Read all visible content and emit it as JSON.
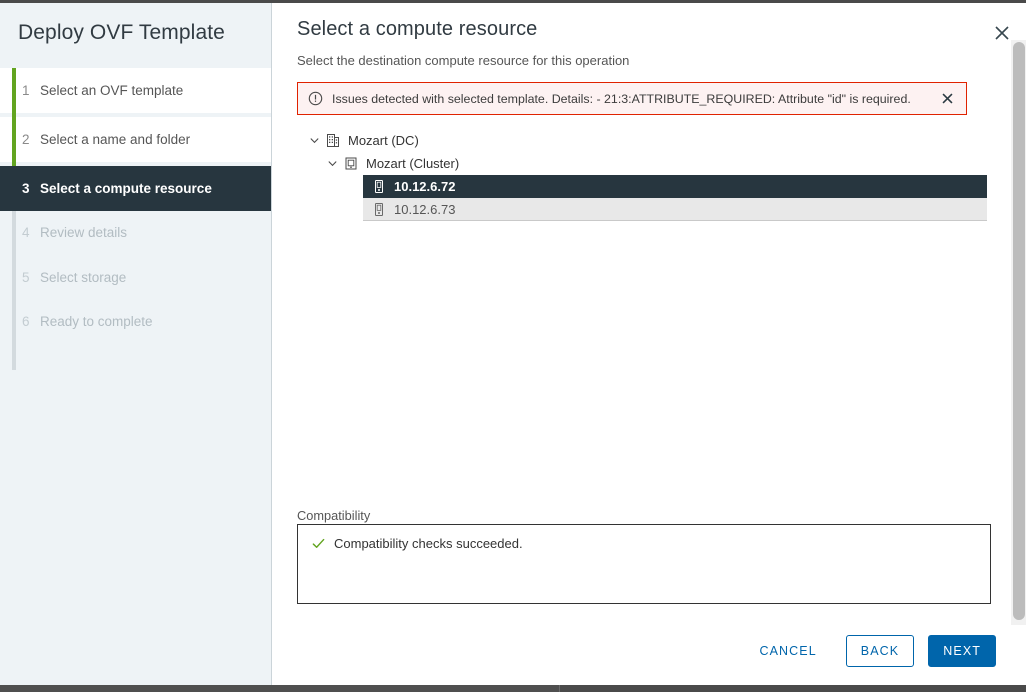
{
  "wizard": {
    "title": "Deploy OVF Template",
    "steps": [
      {
        "num": "1",
        "label": "Select an OVF template",
        "state": "done"
      },
      {
        "num": "2",
        "label": "Select a name and folder",
        "state": "done"
      },
      {
        "num": "3",
        "label": "Select a compute resource",
        "state": "active"
      },
      {
        "num": "4",
        "label": "Review details",
        "state": "off"
      },
      {
        "num": "5",
        "label": "Select storage",
        "state": "off"
      },
      {
        "num": "6",
        "label": "Ready to complete",
        "state": "off"
      }
    ]
  },
  "page": {
    "title": "Select a compute resource",
    "subtitle": "Select the destination compute resource for this operation",
    "close_icon": "close-icon"
  },
  "alert": {
    "icon": "exclamation-circle-icon",
    "message": "Issues detected with selected template. Details: - 21:3:ATTRIBUTE_REQUIRED: Attribute \"id\" is required.",
    "close_icon": "close-icon",
    "border_color": "#e02200",
    "background_color": "#fdf2f2"
  },
  "tree": {
    "datacenter": {
      "label": "Mozart (DC)",
      "icon": "datacenter-icon",
      "chevron": "chevron-down-icon",
      "expanded": true
    },
    "cluster": {
      "label": "Mozart (Cluster)",
      "icon": "cluster-icon",
      "chevron": "chevron-down-icon",
      "expanded": true
    },
    "hosts": [
      {
        "label": "10.12.6.72",
        "icon": "host-icon",
        "state": "selected"
      },
      {
        "label": "10.12.6.73",
        "icon": "host-icon",
        "state": "hovered"
      }
    ]
  },
  "compatibility": {
    "label": "Compatibility",
    "status_icon": "check-icon",
    "status_color": "#62a420",
    "message": "Compatibility checks succeeded."
  },
  "footer": {
    "cancel_label": "CANCEL",
    "back_label": "BACK",
    "next_label": "NEXT",
    "primary_color": "#0065ab"
  },
  "colors": {
    "sidebar_bg": "#eef3f6",
    "active_step_bg": "#27363f",
    "completed_rail": "#62a420",
    "selected_row_bg": "#27363f",
    "hover_row_bg": "#e8e8e8"
  }
}
